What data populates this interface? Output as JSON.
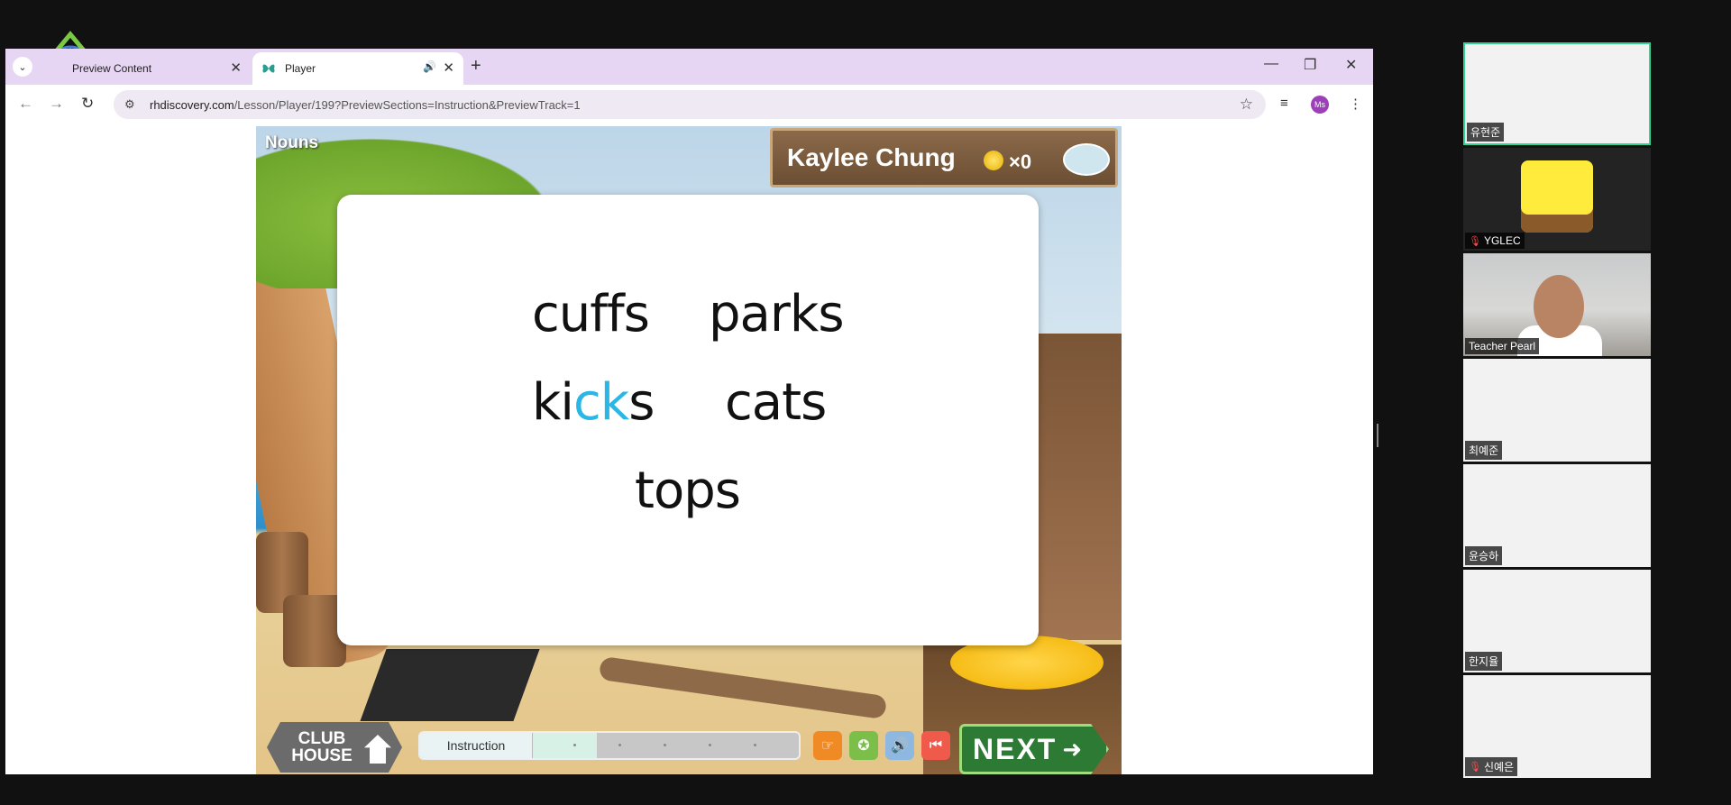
{
  "browser": {
    "tabs": [
      {
        "title": "Preview Content",
        "active": false
      },
      {
        "title": "Player",
        "active": true
      }
    ],
    "url": "rhdiscovery.com/Lesson/Player/199?PreviewSections=Instruction&PreviewTrack=1",
    "url_host": "rhdiscovery.com",
    "url_path": "/Lesson/Player/199?PreviewSections=Instruction&PreviewTrack=1",
    "profile_initials": "Ms"
  },
  "player": {
    "lesson_title": "Nouns",
    "student_name": "Kaylee Chung",
    "coin_count": "×0",
    "words": [
      {
        "pre": "cuffs",
        "hl": "",
        "post": ""
      },
      {
        "pre": "parks",
        "hl": "",
        "post": ""
      },
      {
        "pre": "ki",
        "hl": "ck",
        "post": "s"
      },
      {
        "pre": "cats",
        "hl": "",
        "post": ""
      },
      {
        "pre": "tops",
        "hl": "",
        "post": ""
      }
    ],
    "clubhouse_label": "CLUB HOUSE",
    "progress_label": "Instruction",
    "progress_fraction": 0.24,
    "next_label": "NEXT"
  },
  "participants": [
    {
      "name": "유현준",
      "muted": false
    },
    {
      "name": "YGLEC",
      "muted": true
    },
    {
      "name": "Teacher Pearl",
      "muted": false
    },
    {
      "name": "최예준",
      "muted": false
    },
    {
      "name": "윤승하",
      "muted": false
    },
    {
      "name": "한지율",
      "muted": false
    },
    {
      "name": "신예은",
      "muted": true
    }
  ],
  "colors": {
    "tabstrip": "#e6d6f3",
    "highlight_letters": "#2bb7e6",
    "next_button": "#2d7a35",
    "active_speaker_border": "#32d496"
  }
}
